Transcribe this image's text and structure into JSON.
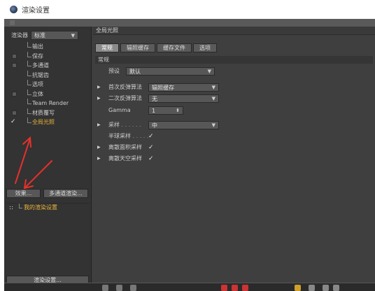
{
  "window": {
    "title": "渲染设置"
  },
  "renderer": {
    "label": "渲染器",
    "value": "标准"
  },
  "effects": [
    {
      "label": "输出",
      "checkbox": "none"
    },
    {
      "label": "保存",
      "checkbox": "off"
    },
    {
      "label": "多通道",
      "checkbox": "off"
    },
    {
      "label": "抗锯齿",
      "checkbox": "none"
    },
    {
      "label": "选项",
      "checkbox": "none"
    },
    {
      "label": "立体",
      "checkbox": "off"
    },
    {
      "label": "Team Render",
      "checkbox": "none"
    },
    {
      "label": "材质覆写",
      "checkbox": "off"
    },
    {
      "label": "全局光照",
      "checkbox": "on",
      "active": true
    }
  ],
  "buttons": {
    "effect": "效果...",
    "multipass": "多通道渲染...",
    "render_settings": "渲染设置..."
  },
  "settings_item": {
    "label": "我的渲染设置"
  },
  "panel": {
    "title": "全局光照",
    "tabs": [
      "常规",
      "辐照缓存",
      "缓存文件",
      "选项"
    ],
    "group": "常规",
    "preset": {
      "label": "预设",
      "value": "默认"
    },
    "primary": {
      "label": "首次反弹算法",
      "value": "辐照缓存"
    },
    "secondary": {
      "label": "二次反弹算法",
      "value": "无"
    },
    "gamma": {
      "label": "Gamma",
      "value": "1"
    },
    "sampling": {
      "label": "采样",
      "dots": ". . . . . .",
      "value": "中"
    },
    "hemi": {
      "label": "半球采样",
      "dots": ". . . . .",
      "check": "✓"
    },
    "discrete_area": {
      "label": "离散面积采样",
      "check": "✓"
    },
    "discrete_sky": {
      "label": "离散天空采样",
      "check": "✓"
    }
  },
  "colors": {
    "accent": "#e8b43a",
    "annotation": "#e8302a"
  }
}
